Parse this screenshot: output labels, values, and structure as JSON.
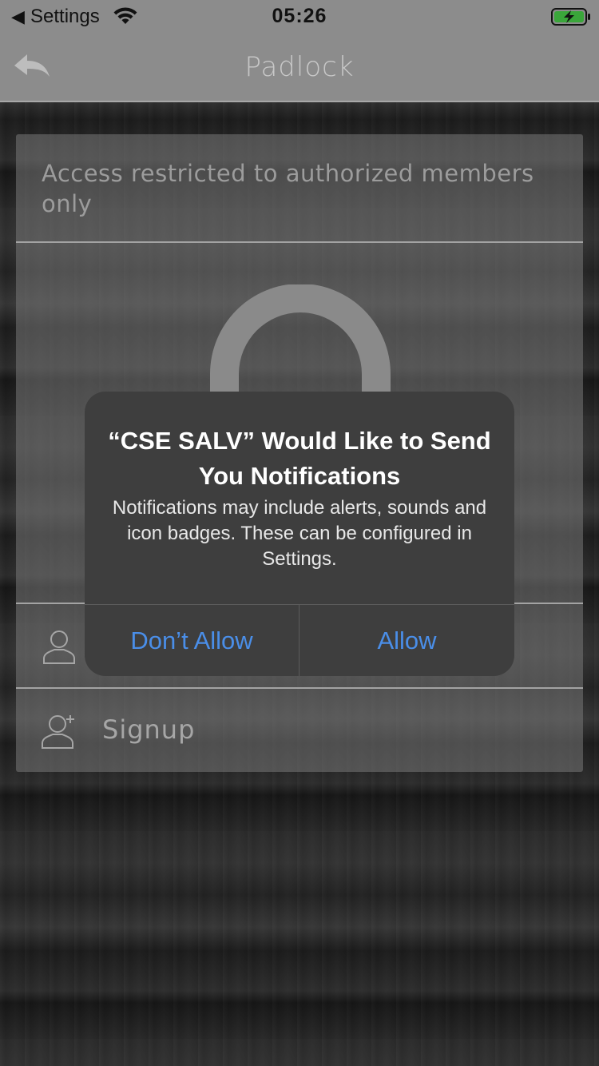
{
  "status_bar": {
    "back_glyph": "◀",
    "back_app": "Settings",
    "time": "05:26",
    "icons": [
      "wifi-icon",
      "battery-charging-icon"
    ]
  },
  "nav": {
    "title": "Padlock",
    "back_icon": "back-arrow-icon"
  },
  "card": {
    "restriction_text": "Access restricted to authorized members only",
    "lock_icon": "padlock-icon",
    "rows": [
      {
        "label": "",
        "icon": "user-icon"
      },
      {
        "label": "Signup",
        "icon": "add-user-icon"
      }
    ]
  },
  "alert": {
    "title": "“CSE SALV” Would Like to Send You Notifications",
    "message": "Notifications may include alerts, sounds and icon badges. These can be configured in Settings.",
    "deny_label": "Don’t Allow",
    "allow_label": "Allow"
  },
  "colors": {
    "accent": "#4a8ee8",
    "alert_bg": "#3e3e3e",
    "battery_charge": "#3aa63a"
  }
}
